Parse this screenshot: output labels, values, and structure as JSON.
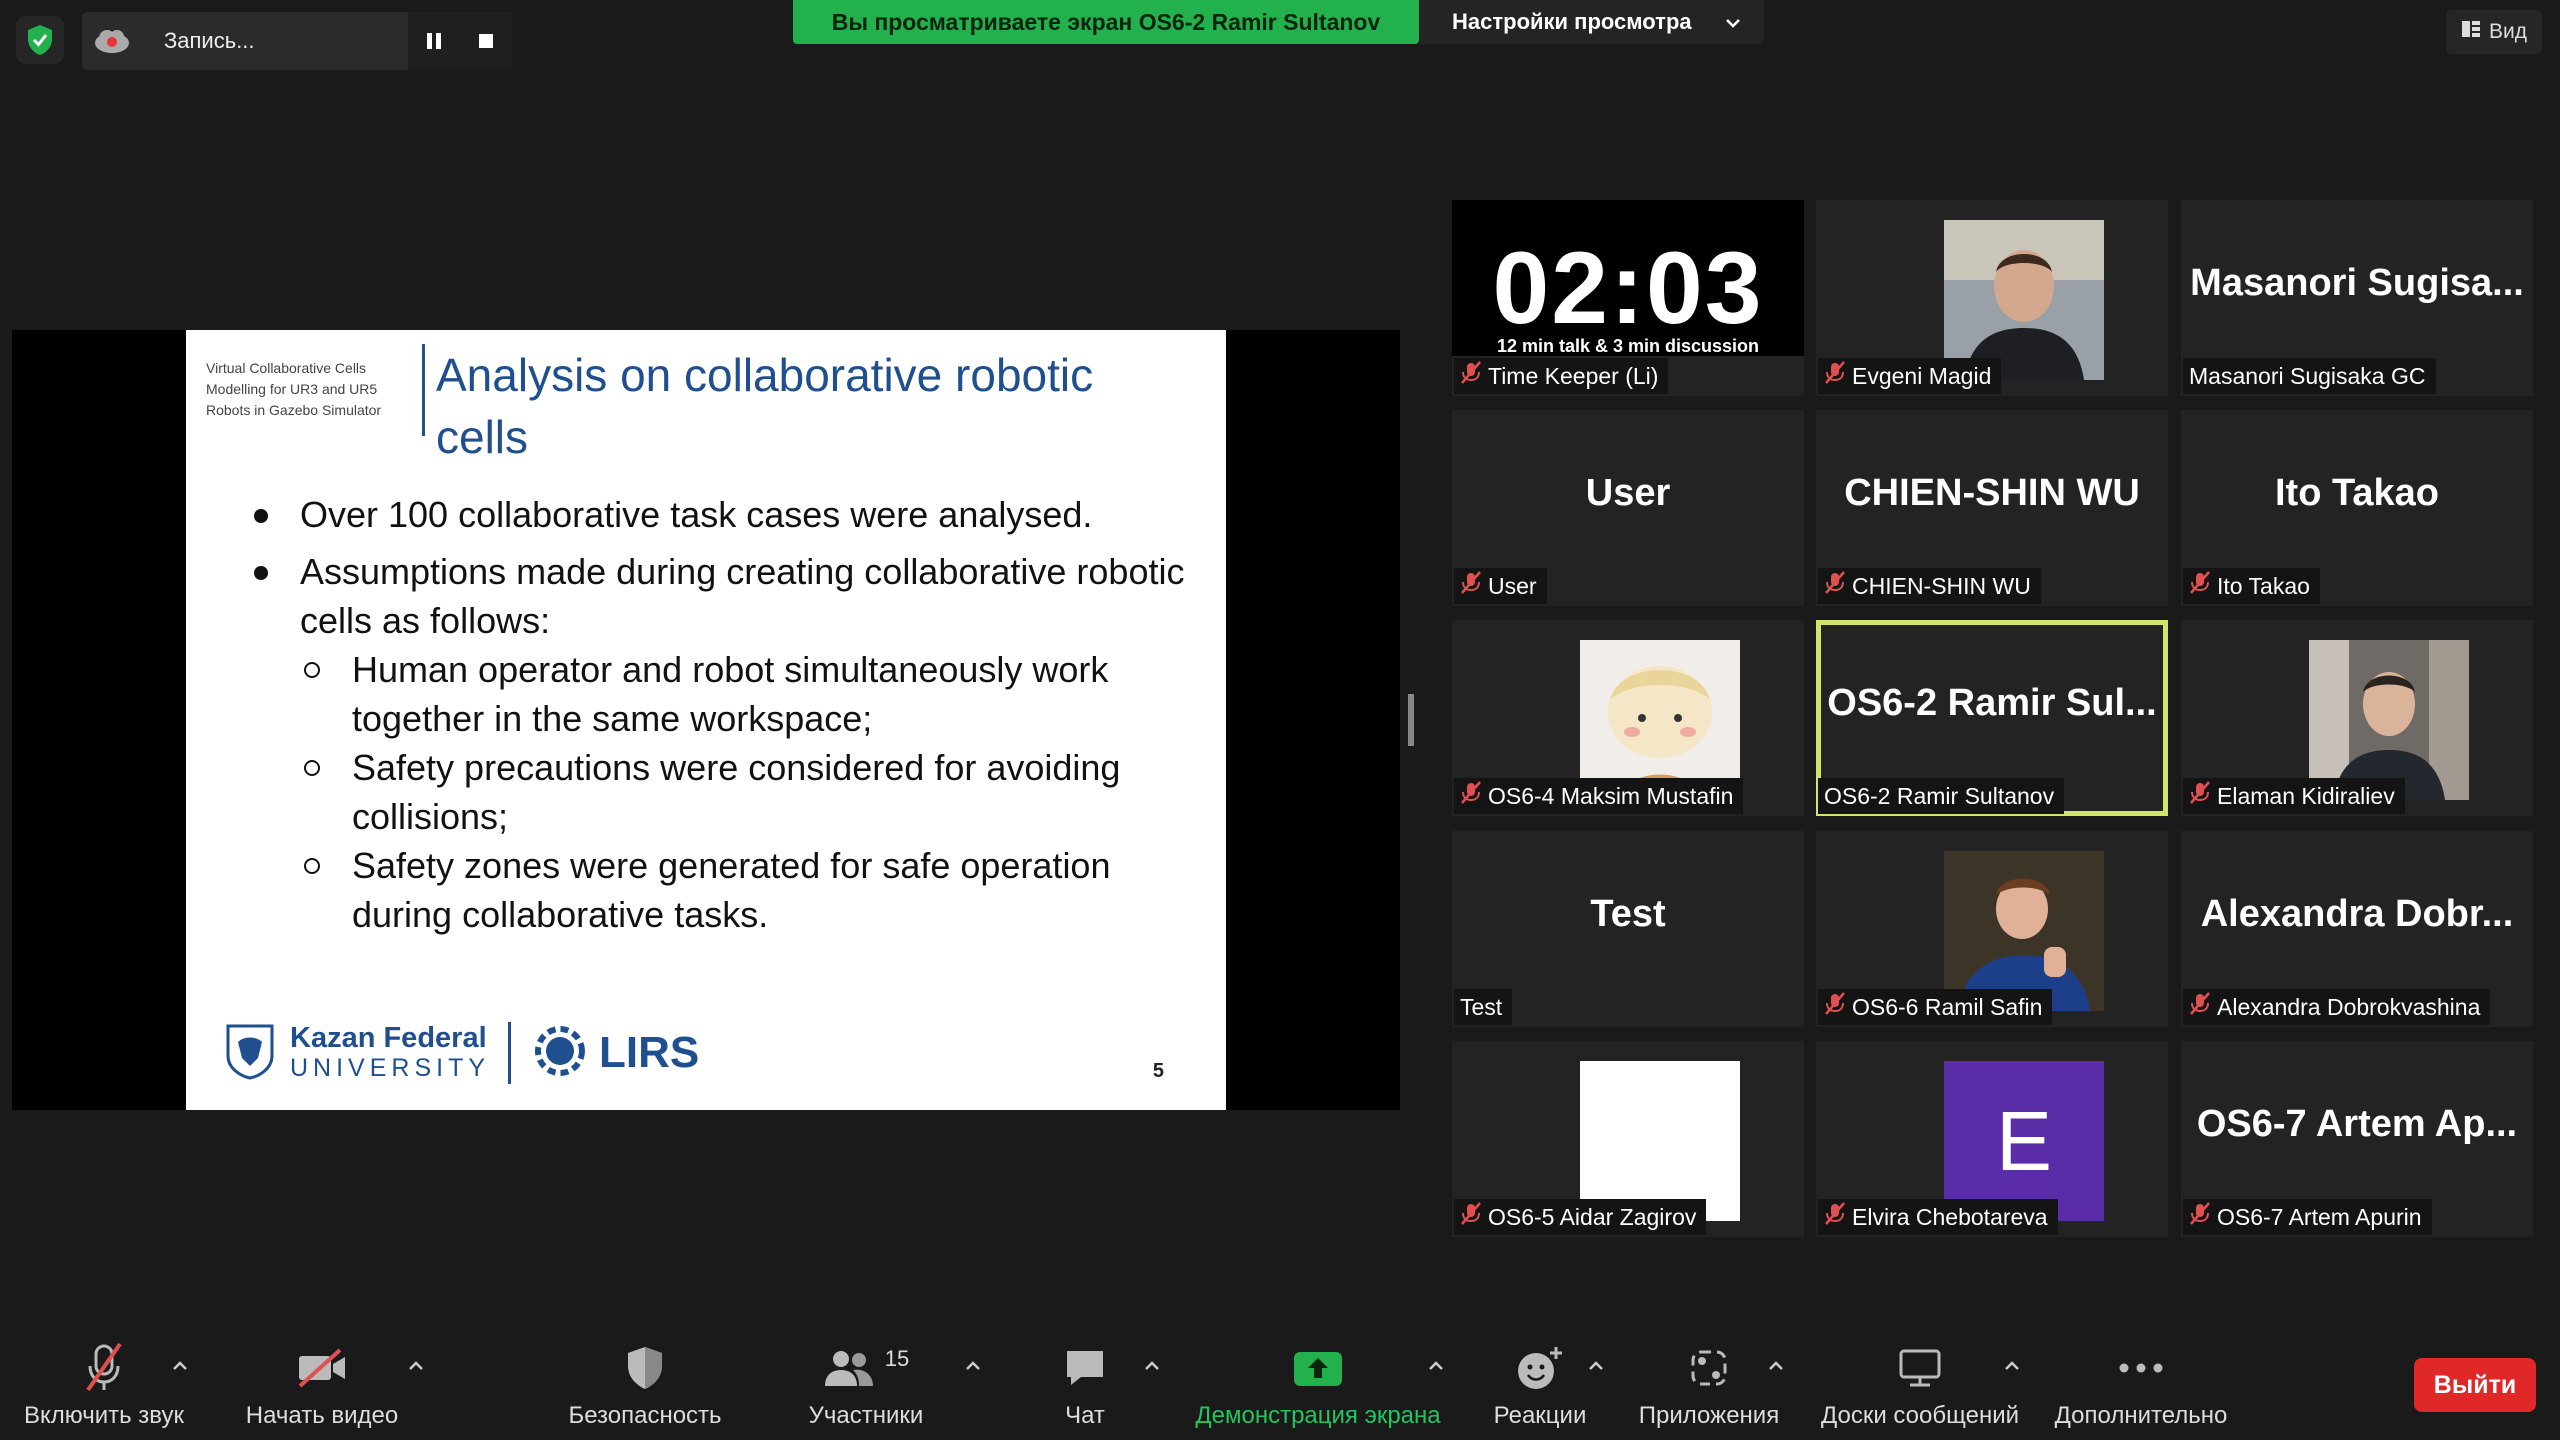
{
  "top": {
    "recording_label": "Запись...",
    "share_banner": "Вы просматриваете экран OS6-2 Ramir Sultanov",
    "view_settings": "Настройки просмотра",
    "view_button": "Вид"
  },
  "slide": {
    "small_title": "Virtual Collaborative Cells Modelling for UR3 and UR5 Robots in Gazebo Simulator",
    "title": "Analysis on collaborative robotic cells",
    "bullet_1": "Over 100 collaborative task cases were analysed.",
    "bullet_2": "Assumptions made during creating collaborative robotic cells as follows:",
    "sub_1": "Human operator and robot simultaneously work together in the same workspace;",
    "sub_2": "Safety precautions were considered for avoiding collisions;",
    "sub_3": "Safety zones were generated for safe operation during collaborative tasks.",
    "kfu_line1": "Kazan Federal",
    "kfu_line2": "UNIVERSITY",
    "lirs": "LIRS",
    "page_number": "5"
  },
  "timer": {
    "clock": "02:03",
    "subtitle": "12 min talk & 3 min discussion"
  },
  "participants": [
    {
      "label": "Time Keeper (Li)",
      "big": ""
    },
    {
      "label": "Evgeni Magid",
      "big": ""
    },
    {
      "label": "Masanori Sugisaka GC",
      "big": "Masanori  Sugisa..."
    },
    {
      "label": "User",
      "big": "User"
    },
    {
      "label": "CHIEN-SHIN WU",
      "big": "CHIEN-SHIN WU"
    },
    {
      "label": "Ito Takao",
      "big": "Ito Takao"
    },
    {
      "label": "OS6-4 Maksim Mustafin",
      "big": ""
    },
    {
      "label": "OS6-2 Ramir Sultanov",
      "big": "OS6-2  Ramir Sul..."
    },
    {
      "label": "Elaman Kidiraliev",
      "big": ""
    },
    {
      "label": "Test",
      "big": "Test"
    },
    {
      "label": "OS6-6 Ramil Safin",
      "big": ""
    },
    {
      "label": "Alexandra Dobrokvashina",
      "big": "Alexandra  Dobr..."
    },
    {
      "label": "OS6-5 Aidar Zagirov",
      "big": ""
    },
    {
      "label": "Elvira Chebotareva",
      "big": "",
      "avatar_letter": "E"
    },
    {
      "label": "OS6-7 Artem Apurin",
      "big": "OS6-7  Artem Ap..."
    }
  ],
  "toolbar": {
    "audio": "Включить звук",
    "video": "Начать видео",
    "security": "Безопасность",
    "participants": "Участники",
    "participants_count": "15",
    "chat": "Чат",
    "share": "Демонстрация экрана",
    "reactions": "Реакции",
    "apps": "Приложения",
    "whiteboards": "Доски сообщений",
    "more": "Дополнительно",
    "leave": "Выйти"
  },
  "colors": {
    "share_green": "#22b14c",
    "active_speaker": "#cfe66b",
    "leave_red": "#e02828",
    "slide_blue": "#1f4f8f",
    "muted_red": "#e05050"
  }
}
